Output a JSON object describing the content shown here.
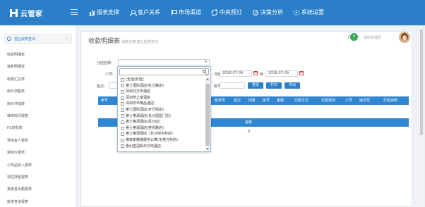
{
  "app": {
    "name": "云管家"
  },
  "nav": [
    {
      "label": "报表支撑"
    },
    {
      "label": "客户关系"
    },
    {
      "label": "市场渠道"
    },
    {
      "label": "中央预订"
    },
    {
      "label": "决策分析"
    },
    {
      "label": "系统设置"
    }
  ],
  "sidebar": {
    "header": "营业报表查询",
    "items": [
      "收款明细表",
      "挂账明细表",
      "收银汇总表",
      "房价调整表",
      "房价冲减表",
      "维修房间报表",
      "PX发报表",
      "预房客人报表",
      "菜房价报表",
      "小商品收入报表",
      "现住押金报表",
      "其者各余额报表",
      "账单查询报表"
    ]
  },
  "page": {
    "title": "收款明细表",
    "subtitle": "报表支撑|营业报表查询",
    "notification_count": "0",
    "user_name": "系统管理员"
  },
  "filters": {
    "branch_label": "分店名称:",
    "staff_label": "工号:",
    "date_label": "日期:",
    "date_from": "2018-07-09",
    "date_to_sep": "到",
    "date_to": "2018-07-09",
    "shift_label": "班次:",
    "room_label": "房号:",
    "search_btn": "查找",
    "print_btn": "打印",
    "export_btn": "导出"
  },
  "table": {
    "columns": [
      "序号",
      "账单号",
      "班次",
      "日期",
      "房号",
      "金额",
      "付款方式",
      "付款类别",
      "工号",
      "操作员",
      "付款说明"
    ],
    "summary_label": "金额",
    "summary_value": "0"
  },
  "dropdown": {
    "options": [
      "[全选/反选]",
      "睿士国际酒店(虹兰路店)",
      "深圳托万布酒店",
      "深圳粤之家酒店",
      "深圳华丰精品酒店",
      "睿士国际酒店(步行街店)",
      "睿士格调酒店(长沙国盈门店)",
      "睿士格调酒店(星沙店)",
      "睿士格调酒店(桂花路店)",
      "睿士格调酒店（长沙树木岭店）",
      "维家斯精度服务公寓(东莞万科店)",
      "惠州皇冠假日万鸣酒店"
    ]
  }
}
